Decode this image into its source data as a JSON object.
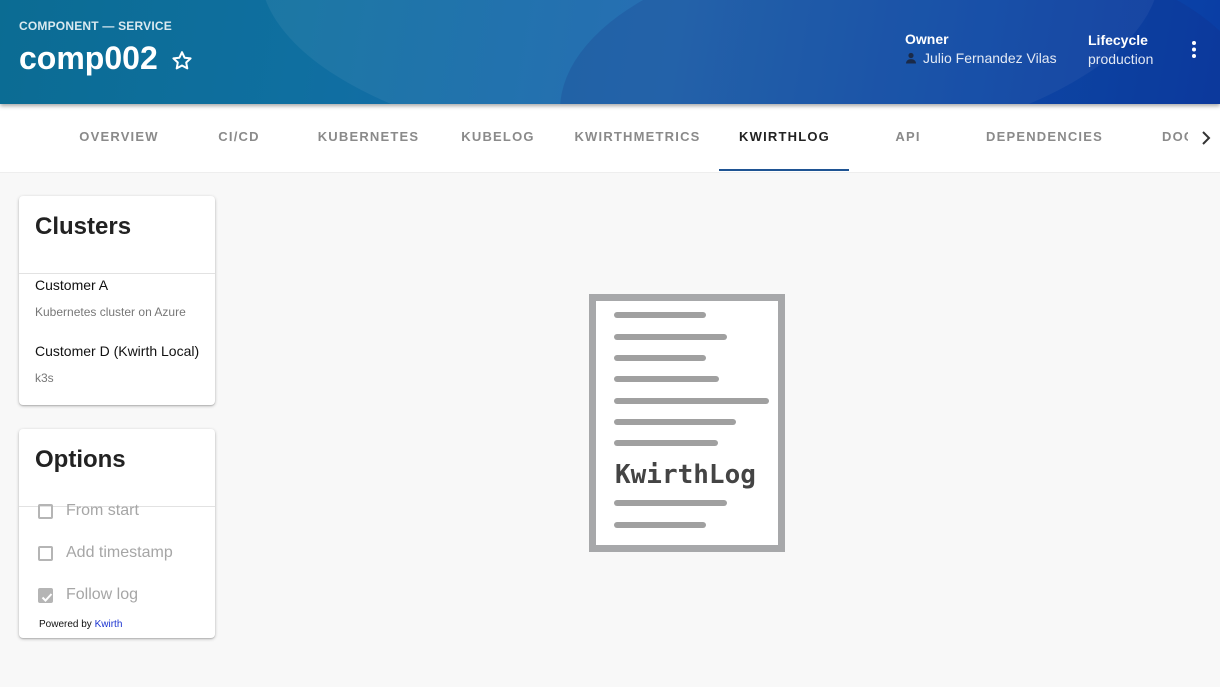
{
  "header": {
    "kicker": "COMPONENT — SERVICE",
    "title": "comp002",
    "owner_label": "Owner",
    "owner_value": "Julio Fernandez Vilas",
    "lifecycle_label": "Lifecycle",
    "lifecycle_value": "production"
  },
  "tabs": [
    {
      "label": "OVERVIEW"
    },
    {
      "label": "CI/CD"
    },
    {
      "label": "KUBERNETES"
    },
    {
      "label": "KUBELOG"
    },
    {
      "label": "KWIRTHMETRICS"
    },
    {
      "label": "KWIRTHLOG"
    },
    {
      "label": "API"
    },
    {
      "label": "DEPENDENCIES"
    },
    {
      "label": "DOCS"
    }
  ],
  "active_tab": "KWIRTHLOG",
  "clusters": {
    "title": "Clusters",
    "items": [
      {
        "name": "Customer A",
        "description": "Kubernetes cluster on Azure"
      },
      {
        "name": "Customer D (Kwirth Local)",
        "description": "k3s"
      }
    ]
  },
  "options": {
    "title": "Options",
    "items": [
      {
        "label": "From start",
        "checked": false
      },
      {
        "label": "Add timestamp",
        "checked": false
      },
      {
        "label": "Follow log",
        "checked": true
      }
    ],
    "powered_prefix": "Powered by",
    "powered_link": "Kwirth"
  },
  "illustration": {
    "caption": "KwirthLog"
  },
  "colors": {
    "accent": "#1f5493",
    "link": "#1a33d0"
  }
}
